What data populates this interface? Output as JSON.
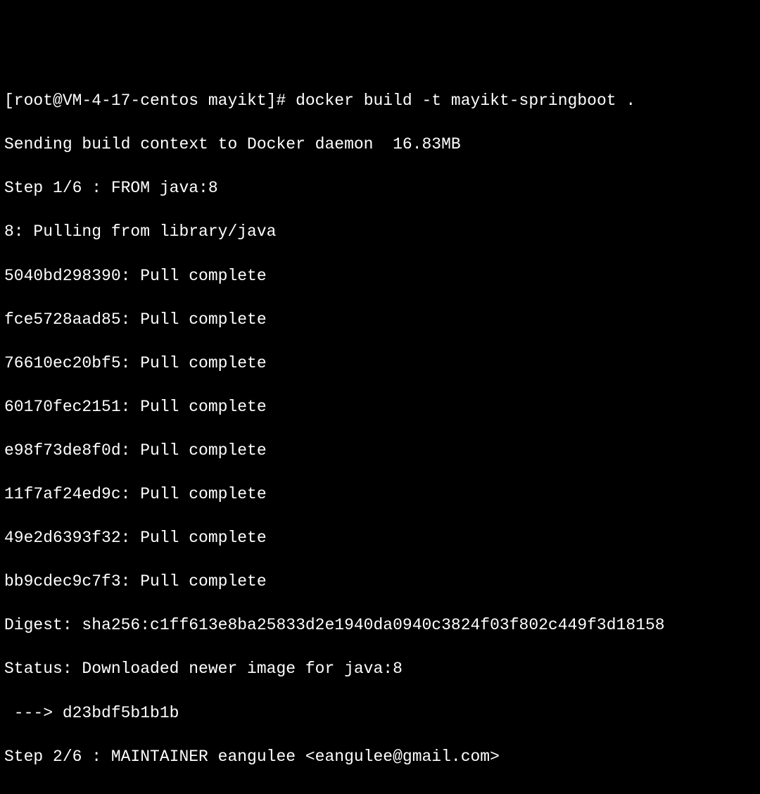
{
  "terminal": {
    "prompt": {
      "full": "[root@VM-4-17-centos mayikt]# "
    },
    "command": "docker build -t mayikt-springboot .",
    "lines": [
      "Sending build context to Docker daemon  16.83MB",
      "Step 1/6 : FROM java:8",
      "8: Pulling from library/java",
      "5040bd298390: Pull complete",
      "fce5728aad85: Pull complete",
      "76610ec20bf5: Pull complete",
      "60170fec2151: Pull complete",
      "e98f73de8f0d: Pull complete",
      "11f7af24ed9c: Pull complete",
      "49e2d6393f32: Pull complete",
      "bb9cdec9c7f3: Pull complete",
      "Digest: sha256:c1ff613e8ba25833d2e1940da0940c3824f03f802c449f3d18158",
      "Status: Downloaded newer image for java:8",
      " ---> d23bdf5b1b1b",
      "Step 2/6 : MAINTAINER eangulee <eangulee@gmail.com>"
    ]
  }
}
